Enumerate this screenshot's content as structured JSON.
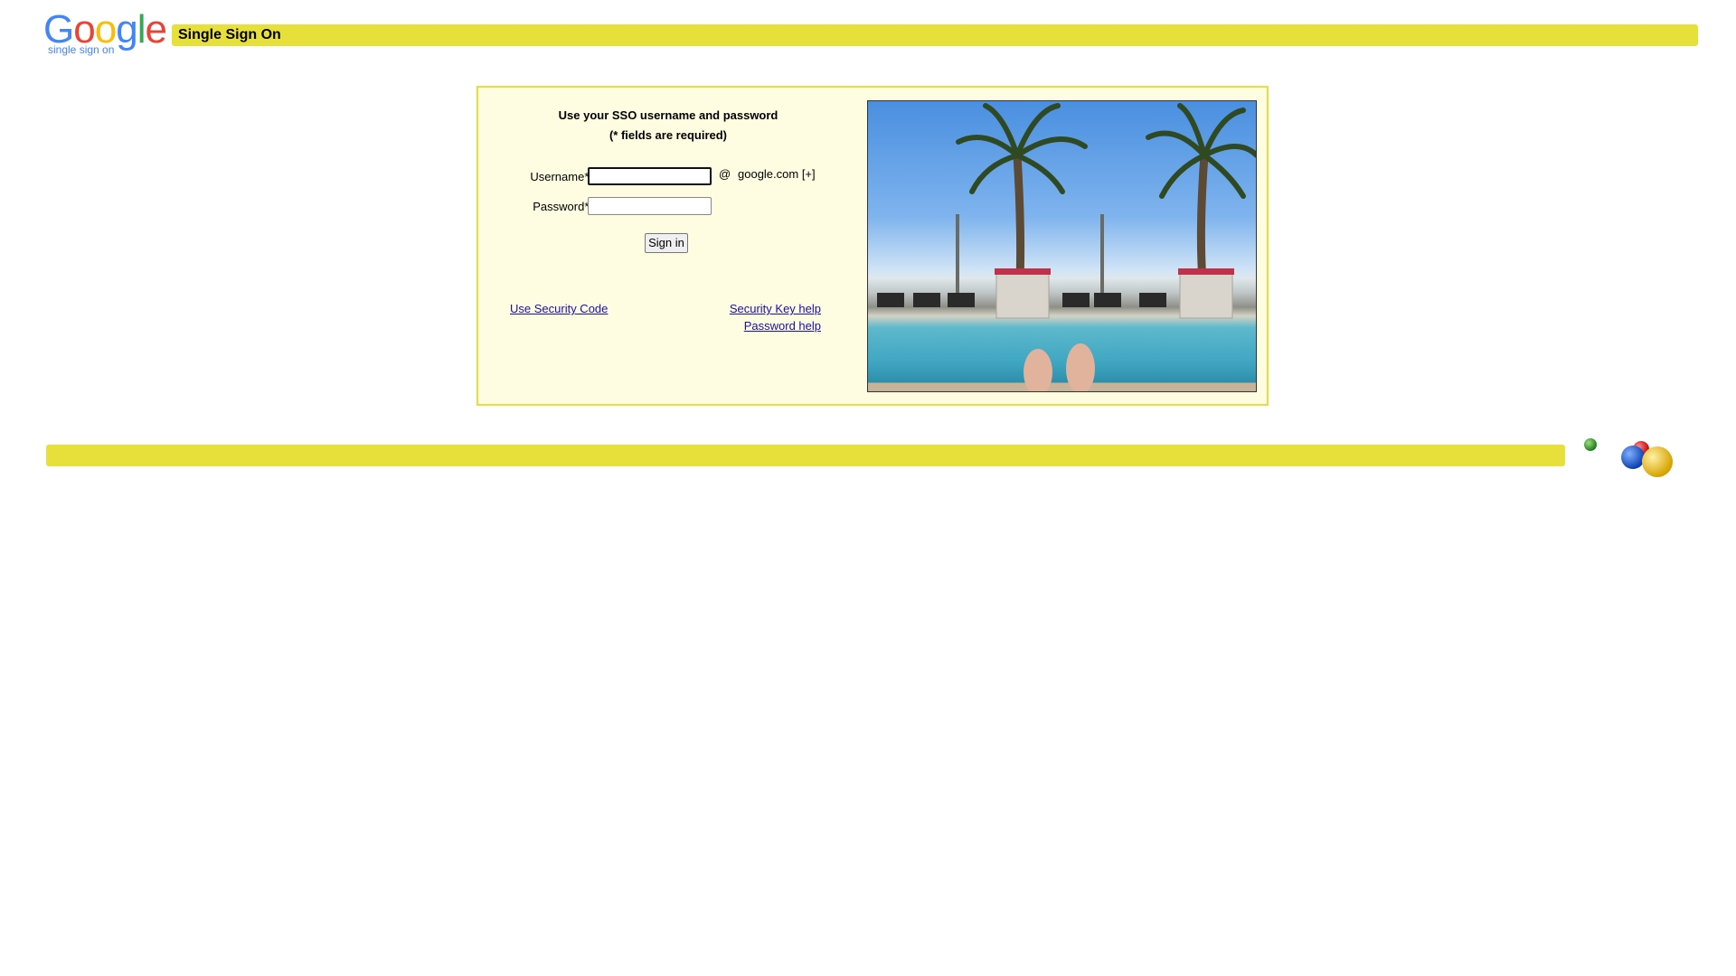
{
  "header": {
    "logo_text": "Google",
    "logo_subtitle": "single sign on",
    "title": "Single Sign On"
  },
  "login": {
    "heading_line1": "Use your SSO username and password",
    "heading_line2": "(* fields are required)",
    "username_label": "Username*:",
    "username_value": "",
    "password_label": "Password*:",
    "password_value": "",
    "at_sign": "@",
    "domain_text": "google.com [+]",
    "signin_label": "Sign in",
    "links": {
      "security_code": "Use Security Code",
      "security_key_help": "Security Key help",
      "password_help": "Password help"
    }
  },
  "colors": {
    "accent_yellow": "#e8e03a",
    "panel_background": "#fffde1",
    "link": "#1a0dab"
  },
  "icons": {
    "logo": "google-logo",
    "decoration": "colored-balls-icon",
    "photo": "poolside-photo"
  }
}
